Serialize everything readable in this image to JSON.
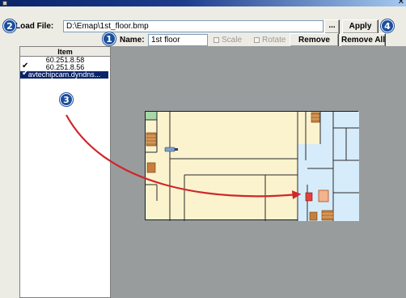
{
  "window": {
    "close_glyph": "✕"
  },
  "load_file": {
    "label": "Load File:",
    "value": "D:\\Emap\\1st_floor.bmp",
    "browse_label": "...",
    "apply_label": "Apply"
  },
  "name_row": {
    "label": "Name:",
    "value": "1st floor",
    "scale_label": "Scale",
    "rotate_label": "Rotate",
    "remove_label": "Remove",
    "remove_all_label": "Remove All"
  },
  "item_list": {
    "header": "Item",
    "items": [
      {
        "label": "60.251.8.58",
        "checked": false,
        "selected": false
      },
      {
        "label": "60.251.8.56",
        "checked": true,
        "selected": false
      },
      {
        "label": "avtechipcam.dyndns...",
        "checked": true,
        "selected": true
      }
    ]
  },
  "callouts": [
    {
      "number": "1",
      "icon": "callout-1"
    },
    {
      "number": "2",
      "icon": "callout-2"
    },
    {
      "number": "3",
      "icon": "callout-3"
    },
    {
      "number": "4",
      "icon": "callout-4"
    }
  ],
  "colors": {
    "title_bar": "#0b246a",
    "callout_blue": "#1b4f9c",
    "arrow_red": "#d0262b",
    "map_background": "#999c9d",
    "floor_yellow": "#fbf3cd",
    "floor_blue": "#d6ecfb",
    "selection": "#0a246a"
  },
  "icons": [
    "close-icon",
    "checkmark-icon",
    "camera-icon",
    "arrow-icon"
  ]
}
